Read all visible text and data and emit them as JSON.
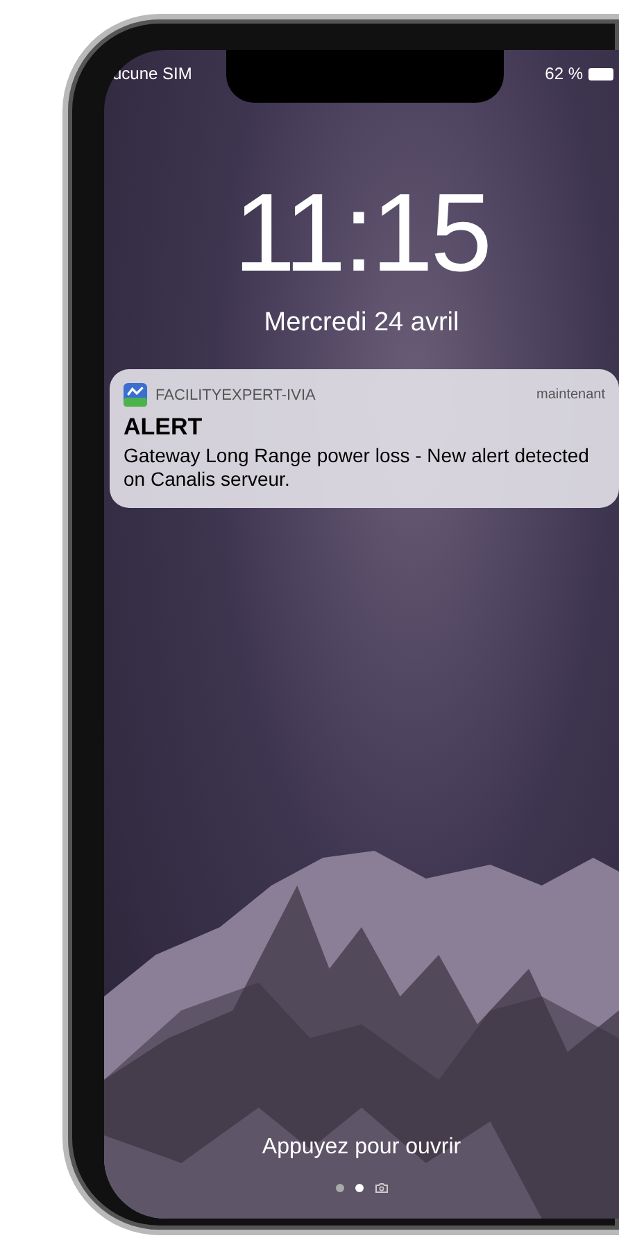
{
  "status_bar": {
    "carrier": "ucune SIM",
    "battery": "62 %"
  },
  "lock_screen": {
    "time": "11:15",
    "date": "Mercredi 24 avril"
  },
  "notification": {
    "app": "FACILITYEXPERT-IVIA",
    "time": "maintenant",
    "title": "ALERT",
    "body": "Gateway Long Range power loss - New alert detected on Canalis serveur."
  },
  "unlock_hint": "Appuyez pour ouvrir",
  "page_dots": [
    {
      "kind": "dot",
      "selected": false
    },
    {
      "kind": "dot",
      "selected": true
    },
    {
      "kind": "camera",
      "selected": false
    }
  ]
}
